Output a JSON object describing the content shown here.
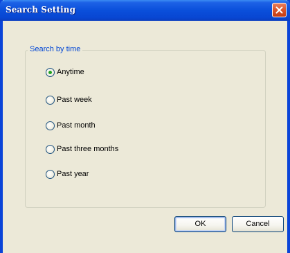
{
  "window": {
    "title": "Search Setting"
  },
  "group": {
    "label": "Search by time"
  },
  "options": [
    {
      "label": "Anytime",
      "checked": true
    },
    {
      "label": "Past week",
      "checked": false
    },
    {
      "label": "Past month",
      "checked": false
    },
    {
      "label": "Past three months",
      "checked": false
    },
    {
      "label": "Past year",
      "checked": false
    }
  ],
  "buttons": {
    "ok": "OK",
    "cancel": "Cancel"
  },
  "icons": {
    "close": "close-icon"
  },
  "colors": {
    "titlebar": "#0a4fdb",
    "group_label": "#0046d5",
    "radio_dot": "#21a121",
    "close_button": "#d9542a"
  }
}
